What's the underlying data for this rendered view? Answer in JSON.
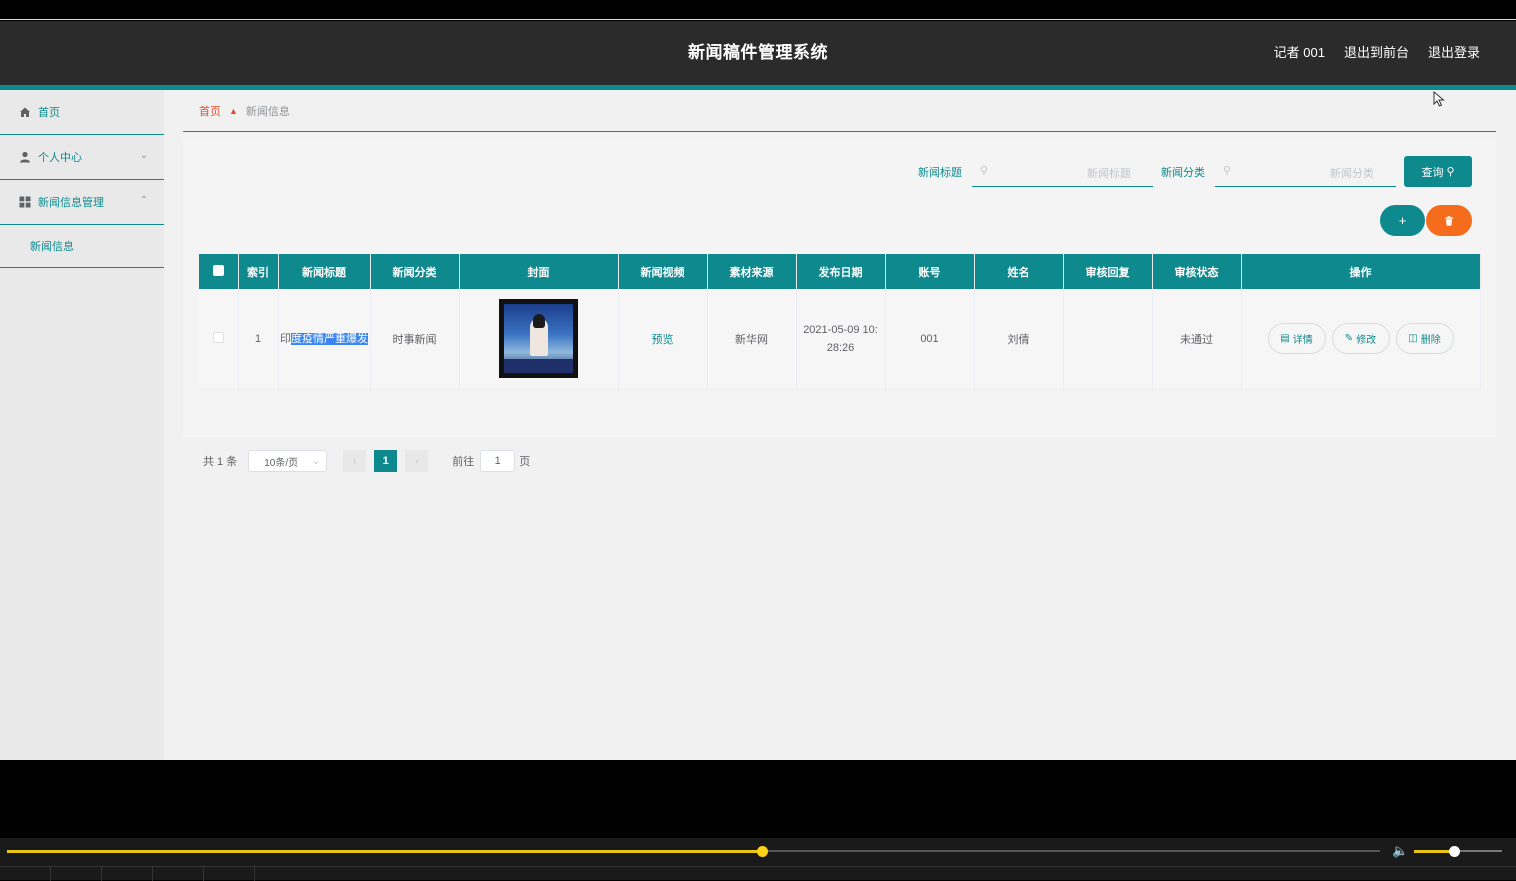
{
  "header": {
    "title": "新闻稿件管理系统",
    "user": "记者 001",
    "to_front": "退出到前台",
    "logout": "退出登录"
  },
  "sidebar": {
    "items": [
      {
        "label": "首页",
        "icon": "home-icon"
      },
      {
        "label": "个人中心",
        "icon": "user-icon"
      },
      {
        "label": "新闻信息管理",
        "icon": "grid-icon"
      }
    ],
    "submenu": "新闻信息"
  },
  "breadcrumb": {
    "home": "首页",
    "current": "新闻信息"
  },
  "search": {
    "title_label": "新闻标题",
    "title_placeholder": "新闻标题",
    "category_label": "新闻分类",
    "category_placeholder": "新闻分类",
    "query_button": "查询"
  },
  "actions": {
    "add": "+",
    "delete_icon": "trash-icon"
  },
  "table": {
    "headers": [
      "索引",
      "新闻标题",
      "新闻分类",
      "封面",
      "新闻视频",
      "素材来源",
      "发布日期",
      "账号",
      "姓名",
      "审核回复",
      "审核状态",
      "操作"
    ],
    "rows": [
      {
        "index": "1",
        "title_plain": "印",
        "title_selected": "度疫情严重爆发",
        "category": "时事新闻",
        "video": "预览",
        "source": "新华网",
        "date": "2021-05-09 10:28:26",
        "account": "001",
        "name": "刘倩",
        "review_reply": "",
        "review_status": "未通过",
        "op_detail": "详情",
        "op_edit": "修改",
        "op_delete": "删除"
      }
    ]
  },
  "pagination": {
    "total": "共 1 条",
    "page_size": "10条/页",
    "current_page": "1",
    "goto_label": "前往",
    "goto_value": "1",
    "goto_suffix": "页"
  },
  "player": {
    "progress": 0.55,
    "volume": 0.45,
    "accent": "#e8c513"
  },
  "colors": {
    "primary": "#0e8a8f",
    "danger": "#f56c1c",
    "header_bg": "#2b2b2b"
  }
}
